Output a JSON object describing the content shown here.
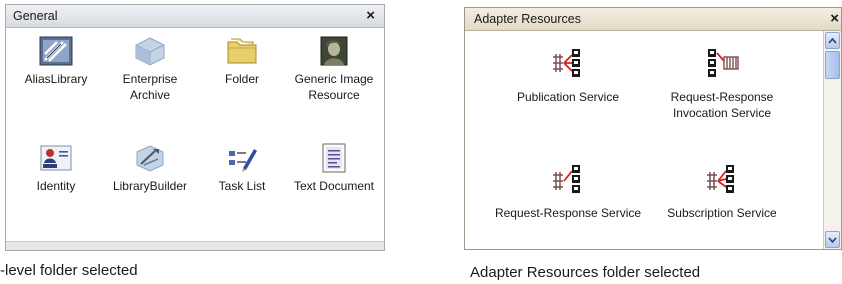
{
  "left_panel": {
    "title": "General",
    "close_glyph": "×",
    "items": [
      {
        "label": "AliasLibrary",
        "icon": "alias-library-icon"
      },
      {
        "label": "Enterprise Archive",
        "icon": "enterprise-archive-icon"
      },
      {
        "label": "Folder",
        "icon": "folder-icon"
      },
      {
        "label": "Generic Image Resource",
        "icon": "generic-image-resource-icon"
      },
      {
        "label": "Identity",
        "icon": "identity-icon"
      },
      {
        "label": "LibraryBuilder",
        "icon": "library-builder-icon"
      },
      {
        "label": "Task List",
        "icon": "task-list-icon"
      },
      {
        "label": "Text Document",
        "icon": "text-document-icon"
      }
    ]
  },
  "right_panel": {
    "title": "Adapter Resources",
    "close_glyph": "×",
    "items": [
      {
        "label": "Publication Service",
        "icon": "publication-service-icon"
      },
      {
        "label": "Request-Response Invocation Service",
        "icon": "request-response-invocation-service-icon"
      },
      {
        "label": "Request-Response Service",
        "icon": "request-response-service-icon"
      },
      {
        "label": "Subscription Service",
        "icon": "subscription-service-icon"
      }
    ]
  },
  "captions": {
    "left": "-level folder selected",
    "right": "Adapter Resources folder selected"
  }
}
